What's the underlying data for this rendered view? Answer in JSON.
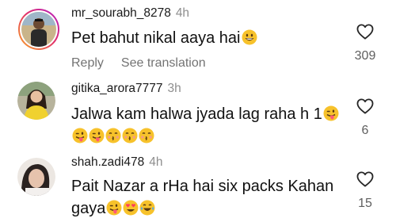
{
  "comments": [
    {
      "username": "mr_sourabh_8278",
      "time": "4h",
      "text": "Pet bahut nikal aaya hai",
      "reply_label": "Reply",
      "translate_label": "See translation",
      "like_count": "309",
      "emojis": [
        "grinning-face"
      ]
    },
    {
      "username": "gitika_arora7777",
      "time": "3h",
      "line1": "Jalwa kam halwa jyada lag raha h 1",
      "like_count": "6",
      "emojis_line1": [
        "winking-tongue-face"
      ],
      "emojis_line2": [
        "winking-tongue-face",
        "winking-tongue-face",
        "face-blowing-kiss",
        "face-blowing-kiss",
        "face-blowing-kiss"
      ]
    },
    {
      "username": "shah.zadi478",
      "time": "4h",
      "line1": "Pait Nazar a rHa hai six packs Kahan",
      "line2": "gaya",
      "like_count": "15",
      "emojis_line2": [
        "winking-tongue-face",
        "heart-eyes-face",
        "tears-of-joy-face"
      ]
    }
  ],
  "colors": {
    "story_ring_start": "#f9a825",
    "story_ring_end": "#d6249f",
    "emoji_yellow": "#f7c22b",
    "heart_red": "#ff3b5c"
  }
}
